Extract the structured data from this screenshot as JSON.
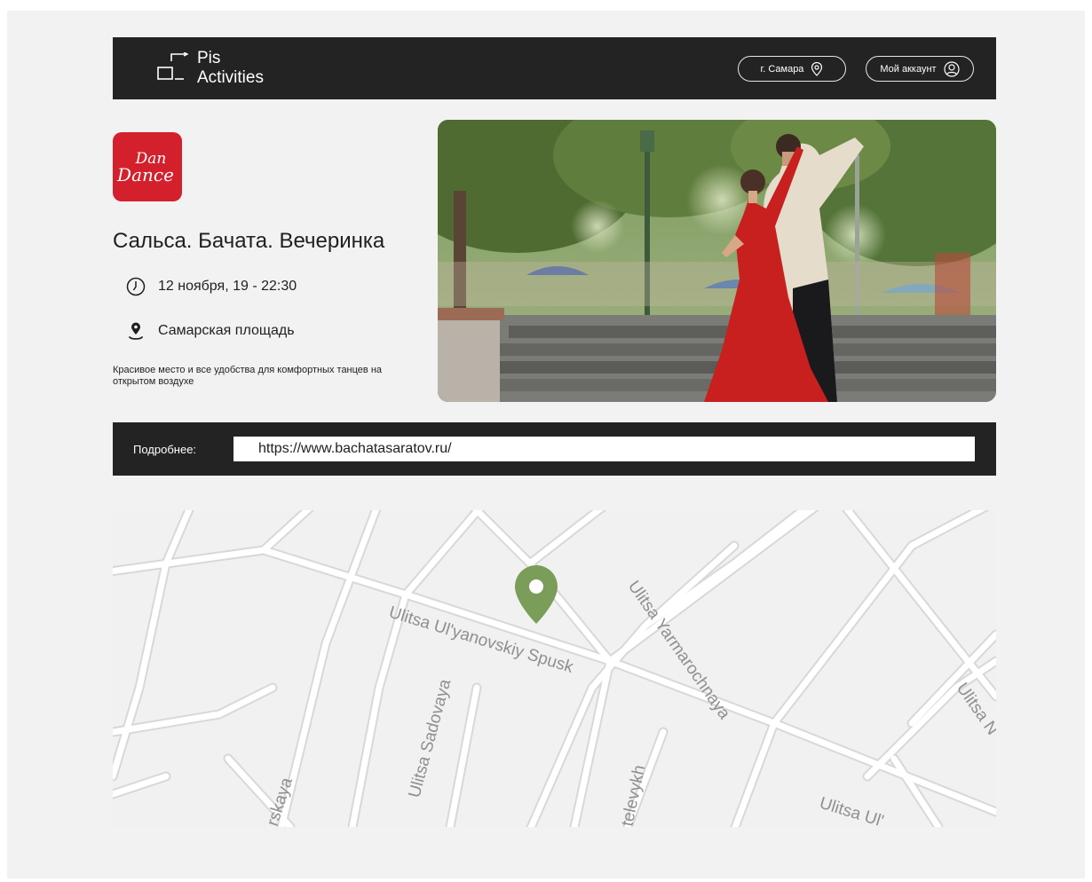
{
  "header": {
    "logo_line1": "Pis",
    "logo_line2": "Activities",
    "city_label": "г. Самара",
    "account_label": "Мой аккаунт"
  },
  "event": {
    "organizer_logo_line1": "Dan",
    "organizer_logo_line2": "Dance",
    "title": "Сальса. Бачата. Вечеринка",
    "datetime": "12 ноября, 19 - 22:30",
    "place": "Самарская площадь",
    "description": "Красивое место и все удобства для комфортных танцев на открытом воздухе"
  },
  "details": {
    "label": "Подробнее:",
    "url": "https://www.bachatasaratov.ru/"
  },
  "map": {
    "street_labels": [
      "Ulitsa Ul'yanovskiy Spusk",
      "Ulitsa Yarmarochnaya",
      "Ulitsa Sadovaya",
      "televykh",
      "rskaya",
      "Ulitsa Ul'",
      "Ulitsa N"
    ],
    "marker_color": "#7a9e5a"
  },
  "icons": {
    "logo": "logo-icon",
    "city": "location-pin-icon",
    "account": "user-icon",
    "time": "clock-icon",
    "place": "map-pin-icon"
  },
  "colors": {
    "dark_bar": "#232323",
    "brand_red": "#d41f2c",
    "page_background": "#f2f2f2"
  }
}
